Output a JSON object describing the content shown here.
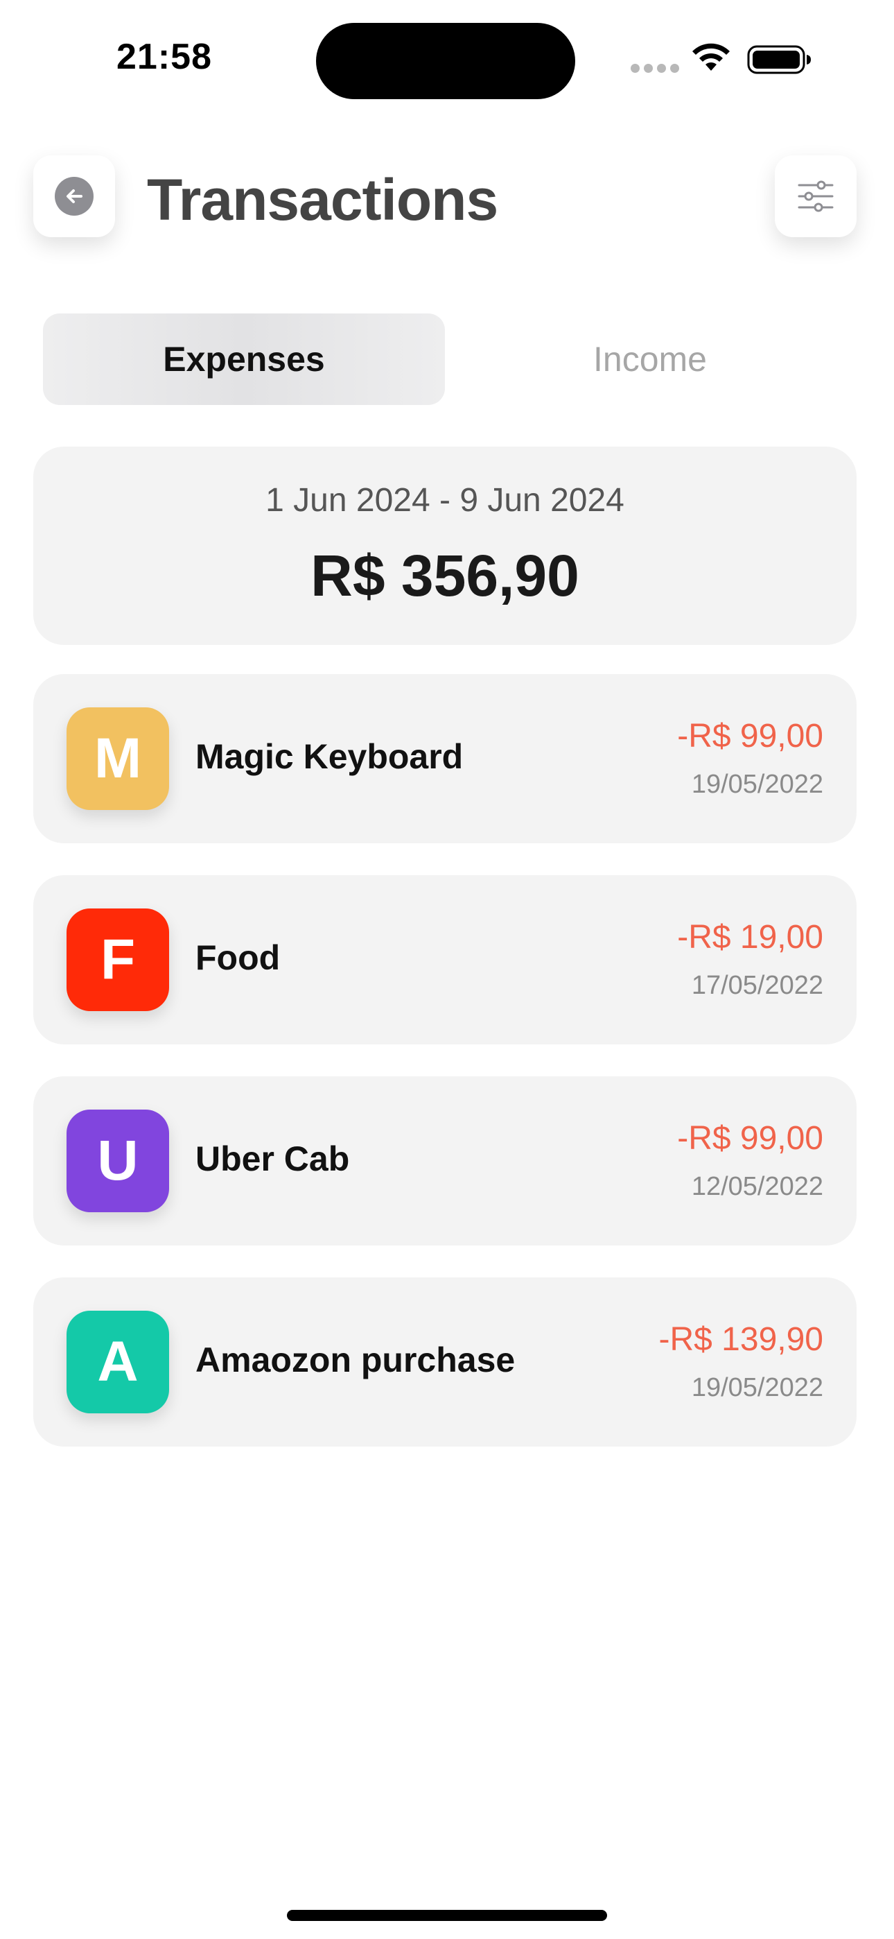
{
  "status_bar": {
    "time": "21:58",
    "icons": [
      "signal-dots-icon",
      "wifi-icon",
      "battery-icon"
    ]
  },
  "header": {
    "title": "Transactions",
    "back_icon": "arrow-left-circle-icon",
    "filter_icon": "sliders-icon"
  },
  "tabs": [
    {
      "label": "Expenses",
      "selected": true
    },
    {
      "label": "Income",
      "selected": false
    }
  ],
  "summary": {
    "date_range": "1 Jun 2024 - 9 Jun 2024",
    "total": "R$ 356,90"
  },
  "transactions": [
    {
      "initial": "M",
      "name": "Magic Keyboard",
      "amount": "-R$ 99,00",
      "date": "19/05/2022",
      "color": "#f2c160"
    },
    {
      "initial": "F",
      "name": "Food",
      "amount": "-R$ 19,00",
      "date": "17/05/2022",
      "color": "#ff2a08"
    },
    {
      "initial": "U",
      "name": "Uber Cab",
      "amount": "-R$ 99,00",
      "date": "12/05/2022",
      "color": "#8145de"
    },
    {
      "initial": "A",
      "name": "Amaozon purchase",
      "amount": "-R$ 139,90",
      "date": "19/05/2022",
      "color": "#14c9a8"
    }
  ],
  "colors": {
    "expense_amount": "#f0634a",
    "card_background": "#f3f3f3",
    "title_text": "#444444"
  }
}
